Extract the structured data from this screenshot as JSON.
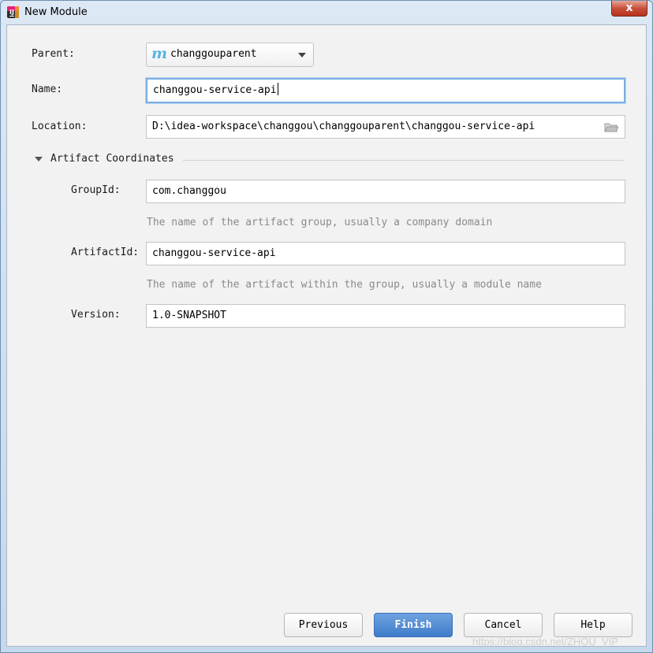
{
  "window": {
    "title": "New Module",
    "close_glyph": "x"
  },
  "form": {
    "parent": {
      "label": "Parent:",
      "value": "changgouparent",
      "icon": "maven-module-icon"
    },
    "name": {
      "label": "Name:",
      "value": "changgou-service-api"
    },
    "location": {
      "label": "Location:",
      "value": "D:\\idea-workspace\\changgou\\changgouparent\\changgou-service-api"
    }
  },
  "artifact": {
    "section_title": "Artifact Coordinates",
    "group_id": {
      "label": "GroupId:",
      "value": "com.changgou",
      "hint": "The name of the artifact group, usually a company domain"
    },
    "artifact_id": {
      "label": "ArtifactId:",
      "value": "changgou-service-api",
      "hint": "The name of the artifact within the group, usually a module name"
    },
    "version": {
      "label": "Version:",
      "value": "1.0-SNAPSHOT"
    }
  },
  "buttons": {
    "previous": "Previous",
    "finish": "Finish",
    "cancel": "Cancel",
    "help": "Help"
  },
  "watermark": "https://blog.csdn.net/ZHOU_VIP",
  "colors": {
    "accent": "#4a88d3",
    "focus_border": "#7aaee3",
    "hint_text": "#8a8a8a"
  }
}
